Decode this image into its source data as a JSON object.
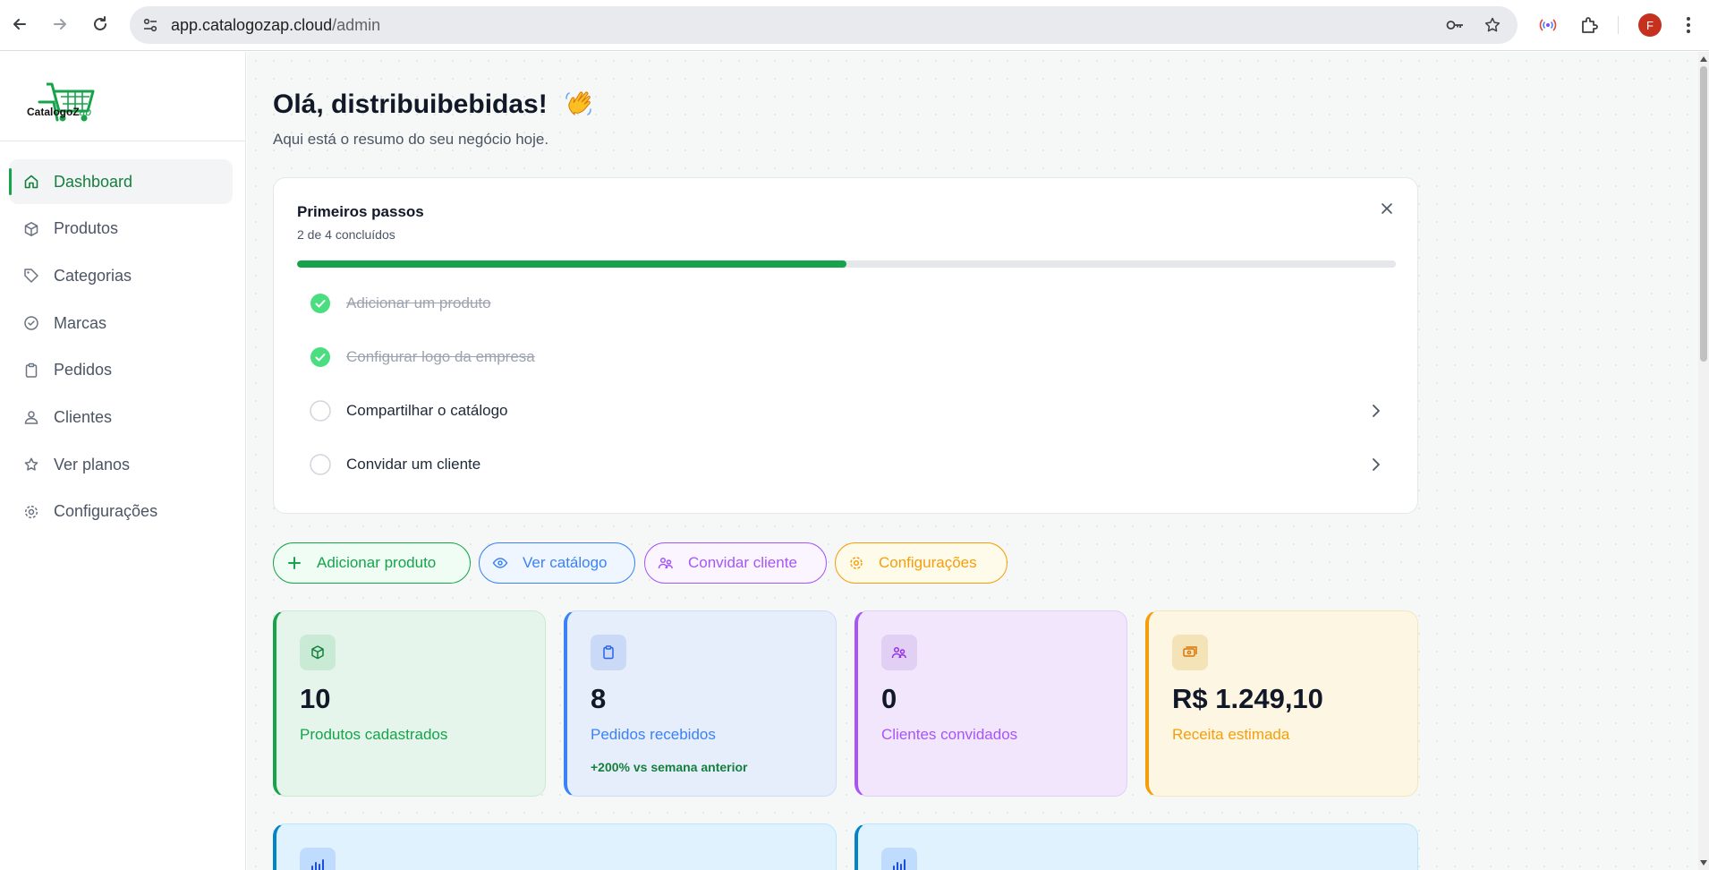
{
  "browser": {
    "url_host": "app.catalogozap.cloud",
    "url_path": "/admin",
    "profile_initial": "F",
    "icons": [
      "back-icon",
      "forward-icon",
      "reload-icon",
      "site-settings-icon",
      "password-key-icon",
      "bookmark-star-icon",
      "cast-icon",
      "extensions-icon",
      "menu-icon"
    ]
  },
  "sidebar": {
    "logo_text_main": "CatalogoZ",
    "logo_text_accent": "ap",
    "items": [
      {
        "label": "Dashboard",
        "icon": "home-icon",
        "active": true
      },
      {
        "label": "Produtos",
        "icon": "box-icon"
      },
      {
        "label": "Categorias",
        "icon": "tag-icon"
      },
      {
        "label": "Marcas",
        "icon": "badge-check-icon"
      },
      {
        "label": "Pedidos",
        "icon": "clipboard-icon"
      },
      {
        "label": "Clientes",
        "icon": "users-icon"
      },
      {
        "label": "Ver planos",
        "icon": "star-icon"
      },
      {
        "label": "Configurações",
        "icon": "gear-icon"
      }
    ]
  },
  "header": {
    "greeting": "Olá, distribuibebidas!",
    "greeting_icon": "waving-hand-icon",
    "subtitle": "Aqui está o resumo do seu negócio hoje."
  },
  "onboarding": {
    "title": "Primeiros passos",
    "progress_text": "2 de 4 concluídos",
    "progress_fraction": 0.5,
    "steps": [
      {
        "label": "Adicionar um produto",
        "done": true
      },
      {
        "label": "Configurar logo da empresa",
        "done": true
      },
      {
        "label": "Compartilhar o catálogo",
        "done": false
      },
      {
        "label": "Convidar um cliente",
        "done": false
      }
    ]
  },
  "actions": [
    {
      "label": "Adicionar produto",
      "icon": "plus-icon",
      "color": "#16a34a"
    },
    {
      "label": "Ver catálogo",
      "icon": "eye-icon",
      "color": "#3b82f6"
    },
    {
      "label": "Convidar cliente",
      "icon": "users-icon",
      "color": "#a855f7"
    },
    {
      "label": "Configurações",
      "icon": "gear-icon",
      "color": "#f59e0b"
    }
  ],
  "stats": [
    {
      "value": "10",
      "label": "Produtos cadastrados",
      "icon": "package-icon",
      "color": "#16a34a"
    },
    {
      "value": "8",
      "label": "Pedidos recebidos",
      "trend": "+200% vs semana anterior",
      "icon": "clipboard-icon",
      "color": "#3b82f6"
    },
    {
      "value": "0",
      "label": "Clientes convidados",
      "icon": "users-icon",
      "color": "#a855f7"
    },
    {
      "value": "R$ 1.249,10",
      "label": "Receita estimada",
      "icon": "money-icon",
      "color": "#f59e0b"
    }
  ],
  "stats_row2_icons": [
    "bar-chart-icon",
    "bar-chart-icon"
  ]
}
